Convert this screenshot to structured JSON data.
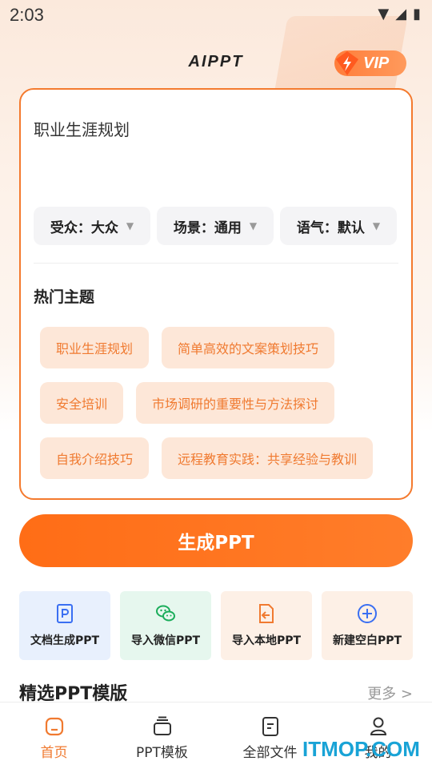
{
  "status": {
    "time": "2:03"
  },
  "header": {
    "title": "AIPPT",
    "vip_label": "VIP"
  },
  "input": {
    "value": "职业生涯规划"
  },
  "selectors": [
    {
      "label": "受众：大众"
    },
    {
      "label": "场景：通用"
    },
    {
      "label": "语气：默认"
    }
  ],
  "hot": {
    "title": "热门主题",
    "chips": [
      "职业生涯规划",
      "简单高效的文案策划技巧",
      "安全培训",
      "市场调研的重要性与方法探讨",
      "自我介绍技巧",
      "远程教育实践：共享经验与教训"
    ]
  },
  "generate_label": "生成PPT",
  "tools": [
    {
      "label": "文档生成PPT",
      "icon": "doc-p-icon",
      "bg": "#e8f0fd",
      "color": "#3a6ff2"
    },
    {
      "label": "导入微信PPT",
      "icon": "wechat-icon",
      "bg": "#e6f7ee",
      "color": "#1aad5a"
    },
    {
      "label": "导入本地PPT",
      "icon": "import-file-icon",
      "bg": "#fdf0e6",
      "color": "#f07a30"
    },
    {
      "label": "新建空白PPT",
      "icon": "plus-circle-icon",
      "bg": "#fdf0e6",
      "color": "#3a6ff2"
    }
  ],
  "section": {
    "title": "精选PPT模版",
    "more": "更多 >"
  },
  "tabs": [
    {
      "label": "首页",
      "icon": "home-icon",
      "active": true
    },
    {
      "label": "PPT模板",
      "icon": "template-icon",
      "active": false
    },
    {
      "label": "全部文件",
      "icon": "files-icon",
      "active": false
    },
    {
      "label": "我的",
      "icon": "user-icon",
      "active": false
    }
  ],
  "watermark": "ITMOP.COM",
  "colors": {
    "accent": "#f47a2e",
    "chip_bg": "#fde7d8",
    "chip_text": "#f07a30"
  }
}
